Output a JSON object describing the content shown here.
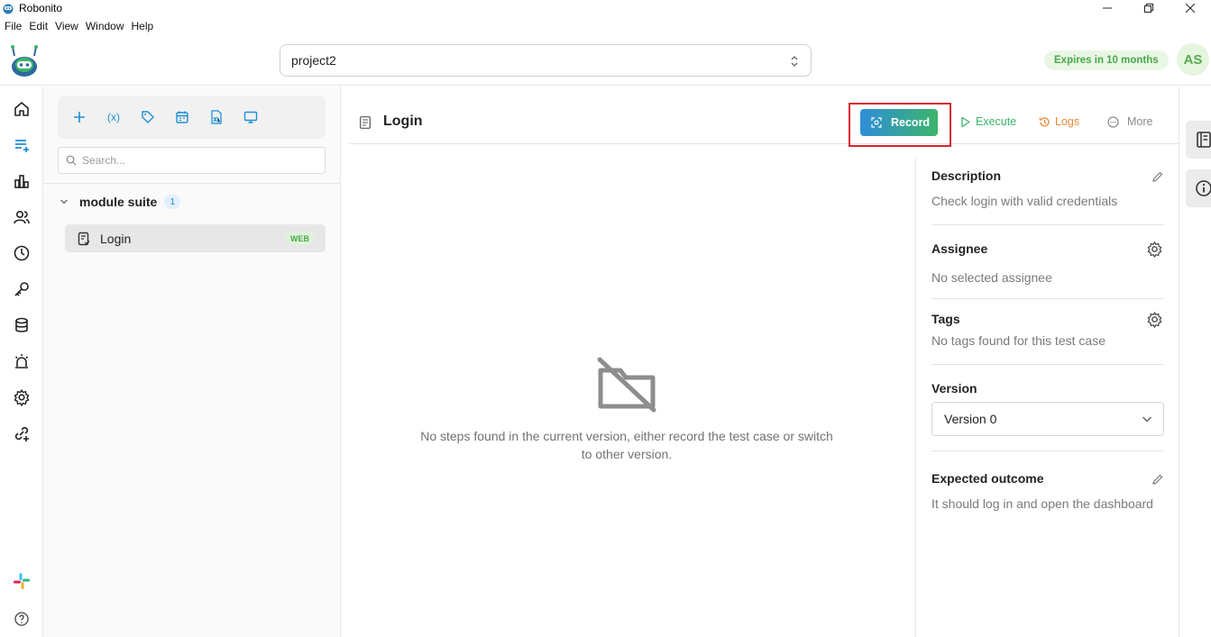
{
  "window": {
    "title": "Robonito",
    "controls": [
      "minimize",
      "restore",
      "close"
    ]
  },
  "menu": [
    "File",
    "Edit",
    "View",
    "Window",
    "Help"
  ],
  "header": {
    "project_value": "project2",
    "expires_label": "Expires in 10 months",
    "avatar_initials": "AS"
  },
  "rail": {
    "items": [
      "home-icon",
      "test-cases-icon",
      "reports-icon",
      "users-icon",
      "history-icon",
      "keys-icon",
      "database-icon",
      "alerts-icon",
      "settings-icon",
      "integrations-icon"
    ],
    "bottom": [
      "slack-icon",
      "help-icon"
    ]
  },
  "tree": {
    "toolbar": [
      "add-icon",
      "variables-icon",
      "tag-icon",
      "schedule-icon",
      "excel-icon",
      "monitor-icon"
    ],
    "toolbar_variable_label": "(x)",
    "search_placeholder": "Search...",
    "suite": {
      "name": "module suite",
      "count": "1"
    },
    "cases": [
      {
        "name": "Login",
        "badge": "WEB"
      }
    ]
  },
  "main": {
    "title": "Login",
    "actions": {
      "record": "Record",
      "execute": "Execute",
      "logs": "Logs",
      "more": "More"
    },
    "empty_message": "No steps found in the current version, either record the test case or switch to other version."
  },
  "details": {
    "description": {
      "title": "Description",
      "value": "Check login with valid credentials"
    },
    "assignee": {
      "title": "Assignee",
      "value": "No selected assignee"
    },
    "tags": {
      "title": "Tags",
      "value": "No tags found for this test case"
    },
    "version": {
      "title": "Version",
      "value": "Version 0"
    },
    "expected": {
      "title": "Expected outcome",
      "value": "It should log in and open the dashboard"
    }
  },
  "colors": {
    "accent_blue": "#1e8fd6",
    "accent_green": "#3bb56a",
    "logs_orange": "#e8893a",
    "highlight_red": "#d8262e"
  }
}
